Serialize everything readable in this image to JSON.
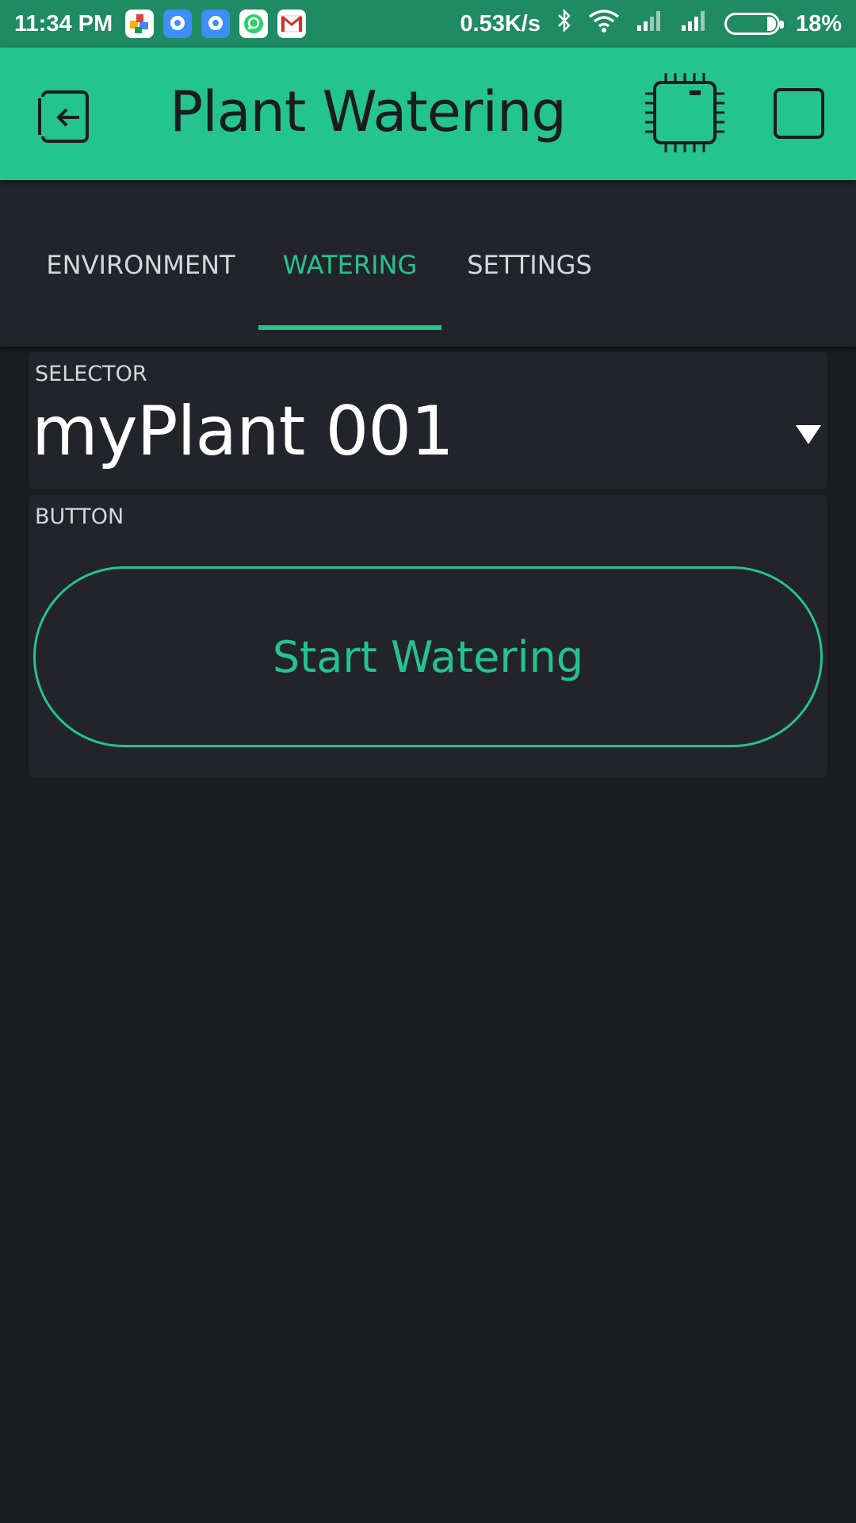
{
  "status_bar": {
    "time": "11:34 PM",
    "speed": "0.53K/s",
    "battery": "18%",
    "battery_level": 0.18,
    "notification_icons": [
      "puzzle-app-icon",
      "messenger-icon",
      "messenger-icon",
      "whatsapp-icon",
      "gmail-icon"
    ]
  },
  "app_bar": {
    "title": "Plant Watering",
    "back_icon": "exit-icon",
    "device_icon": "chip-icon",
    "play_icon": "stop-square-icon"
  },
  "tabs": [
    {
      "label": "ENVIRONMENT",
      "active": false
    },
    {
      "label": "WATERING",
      "active": true
    },
    {
      "label": "SETTINGS",
      "active": false
    }
  ],
  "selector": {
    "label": "SELECTOR",
    "value": "myPlant 001"
  },
  "button_widget": {
    "label": "BUTTON",
    "button_text": "Start Watering"
  },
  "colors": {
    "accent": "#23c48e",
    "status_bar": "#1f8a63",
    "background": "#1b1c20",
    "widget_bg": "#232429"
  }
}
